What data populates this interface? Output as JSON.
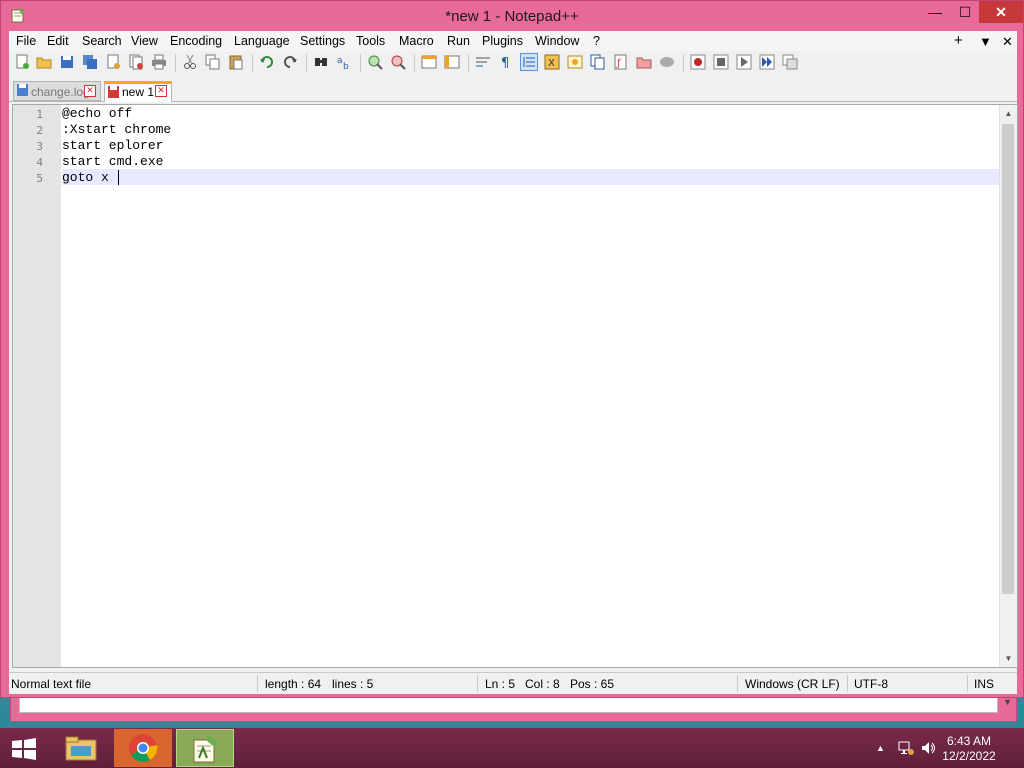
{
  "window": {
    "title": "*new 1 - Notepad++",
    "minimize": "—",
    "maximize": "☐",
    "close": "✕"
  },
  "menu": [
    "File",
    "Edit",
    "Search",
    "View",
    "Encoding",
    "Language",
    "Settings",
    "Tools",
    "Macro",
    "Run",
    "Plugins",
    "Window",
    "?"
  ],
  "menu_right": {
    "add": "+",
    "dropdown": "▼",
    "close": "✕"
  },
  "tabs": [
    {
      "label": "change.log",
      "active": false
    },
    {
      "label": "new 1",
      "active": true
    }
  ],
  "editor": {
    "lines": [
      {
        "num": "1",
        "text": "@echo off"
      },
      {
        "num": "2",
        "text": ":Xstart chrome"
      },
      {
        "num": "3",
        "text": "start eplorer"
      },
      {
        "num": "4",
        "text": "start cmd.exe"
      },
      {
        "num": "5",
        "text": "goto x "
      }
    ]
  },
  "status": {
    "file_type": "Normal text file",
    "length": "length : 64",
    "lines": "lines : 5",
    "ln": "Ln : 5",
    "col": "Col : 8",
    "pos": "Pos : 65",
    "eol": "Windows (CR LF)",
    "encoding": "UTF-8",
    "mode": "INS"
  },
  "taskbar": {
    "time": "6:43 AM",
    "date": "12/2/2022",
    "tray_up": "▲"
  },
  "colors": {
    "window_frame": "#e8699a",
    "close_button": "#c7383a",
    "active_tab_accent": "#f5a623",
    "current_line": "#e8e8ff",
    "taskbar": "#6b2444"
  }
}
